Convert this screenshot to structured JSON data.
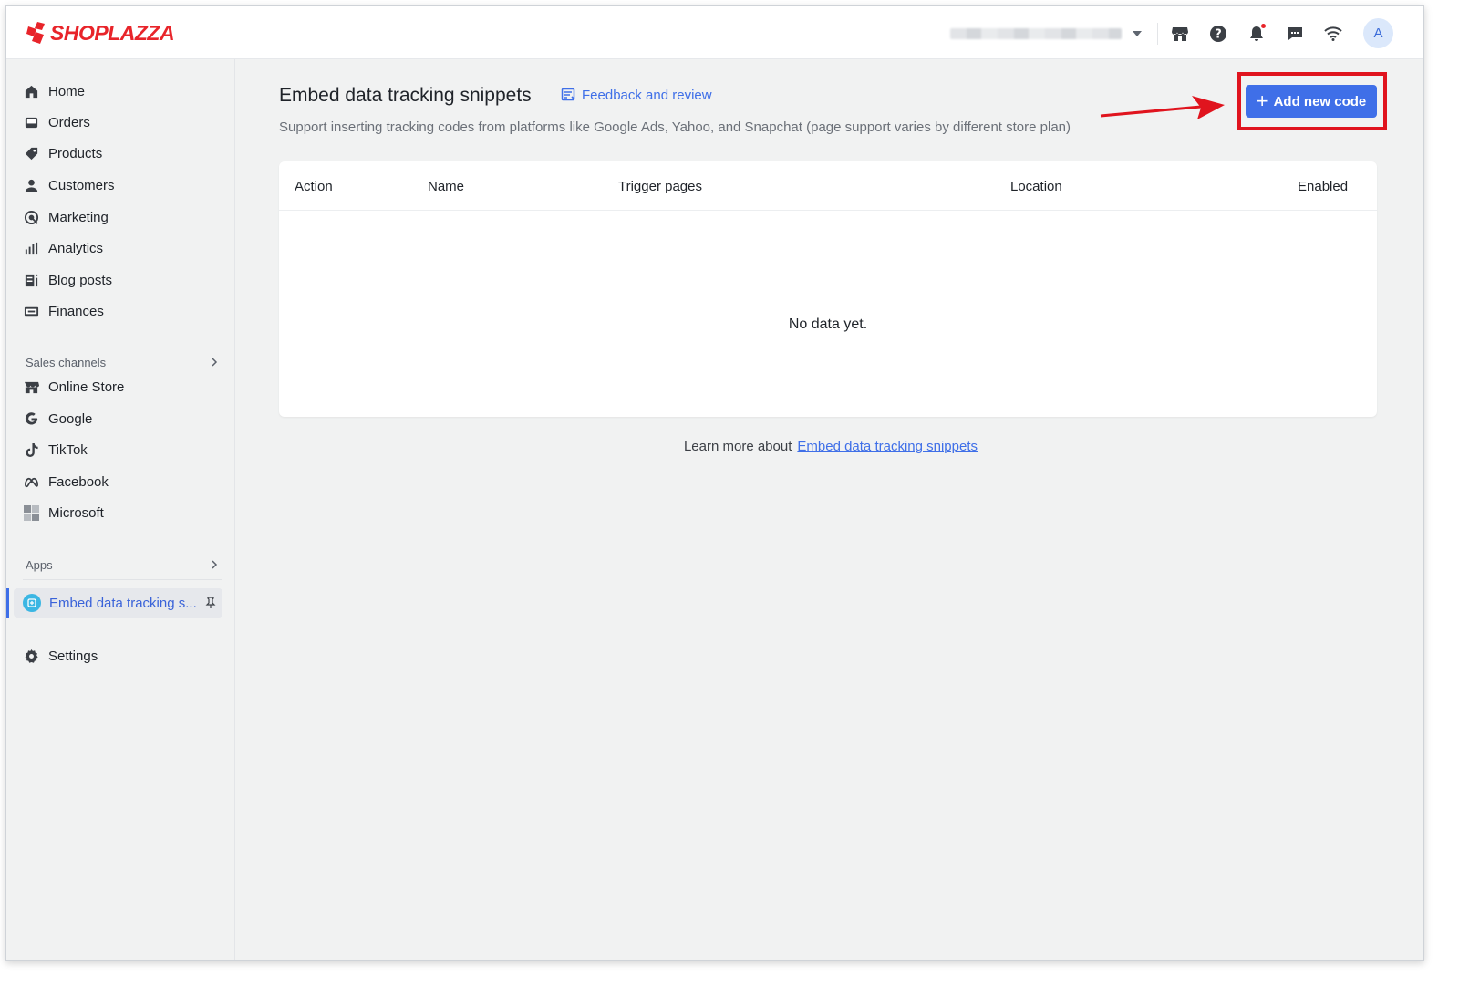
{
  "topbar": {
    "brand": "SHOPLAZZA",
    "avatar_initial": "A",
    "icons": [
      "store-icon",
      "help-icon",
      "bell-icon",
      "chat-icon",
      "wifi-icon"
    ]
  },
  "sidebar": {
    "main_items": [
      {
        "label": "Home",
        "icon": "home-icon"
      },
      {
        "label": "Orders",
        "icon": "orders-icon"
      },
      {
        "label": "Products",
        "icon": "tag-icon"
      },
      {
        "label": "Customers",
        "icon": "person-icon"
      },
      {
        "label": "Marketing",
        "icon": "marketing-icon"
      },
      {
        "label": "Analytics",
        "icon": "bar-chart-icon"
      },
      {
        "label": "Blog posts",
        "icon": "blog-icon"
      },
      {
        "label": "Finances",
        "icon": "finance-icon"
      }
    ],
    "sales_channels_label": "Sales channels",
    "channels": [
      {
        "label": "Online Store",
        "icon": "store-icon"
      },
      {
        "label": "Google",
        "icon": "google-icon"
      },
      {
        "label": "TikTok",
        "icon": "tiktok-icon"
      },
      {
        "label": "Facebook",
        "icon": "meta-icon"
      },
      {
        "label": "Microsoft",
        "icon": "microsoft-icon"
      }
    ],
    "apps_label": "Apps",
    "active_app": "Embed data tracking s...",
    "settings_label": "Settings"
  },
  "main": {
    "title": "Embed data tracking snippets",
    "feedback_label": "Feedback and review",
    "subtitle": "Support inserting tracking codes from platforms like Google Ads, Yahoo, and Snapchat (page support varies by different store plan)",
    "add_button_label": "Add new code",
    "table": {
      "columns": [
        "Action",
        "Name",
        "Trigger pages",
        "Location",
        "Enabled"
      ],
      "empty_text": "No data yet."
    },
    "learn_more_prefix": "Learn more about",
    "learn_more_link": "Embed data tracking snippets"
  },
  "colors": {
    "brand_red": "#e8242a",
    "primary_blue": "#3f6fe8",
    "highlight_red": "#e0141e",
    "background": "#f1f2f2"
  }
}
